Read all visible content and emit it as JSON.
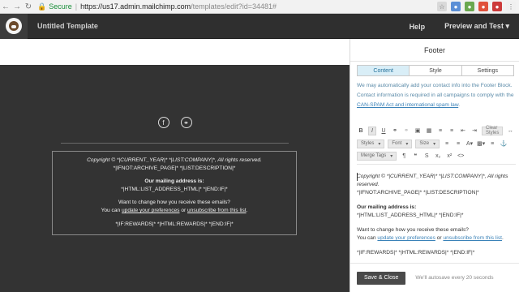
{
  "browser": {
    "secure_label": "Secure",
    "url_host": "https://us17.admin.mailchimp.com",
    "url_path": "/templates/edit?id=34481#"
  },
  "header": {
    "template_title": "Untitled Template",
    "help": "Help",
    "preview": "Preview and Test"
  },
  "canvas": {
    "footer_lines": {
      "copyright": "Copyright © *|CURRENT_YEAR|* *|LIST:COMPANY|*, All rights reserved.",
      "archive": "*|IFNOT:ARCHIVE_PAGE|* *|LIST:DESCRIPTION|*",
      "mailing_heading": "Our mailing address is:",
      "address": "*|HTML:LIST_ADDRESS_HTML|* *|END:IF|*",
      "change_q": "Want to change how you receive these emails?",
      "you_can": "You can ",
      "update_link": "update your preferences",
      "or": " or ",
      "unsub_link": "unsubscribe from this list",
      "period": ".",
      "rewards": "*|IF:REWARDS|* *|HTML:REWARDS|* *|END:IF|*"
    }
  },
  "panel": {
    "title": "Footer",
    "tabs": [
      "Content",
      "Style",
      "Settings"
    ],
    "active_tab": "Content",
    "info_text": "We may automatically add your contact info into the Footer Block. Contact information is required in all campaigns to comply with the ",
    "info_link": "CAN-SPAM Act and international spam law",
    "info_end": ".",
    "toolbar": {
      "clear_styles": "Clear Styles",
      "styles": "Styles",
      "font": "Font",
      "size": "Size",
      "merge_tags": "Merge Tags"
    },
    "editor": {
      "copyright": "Copyright © *|CURRENT_YEAR|* *|LIST:COMPANY|*, All rights reserved.",
      "archive": "*|IFNOT:ARCHIVE_PAGE|* *|LIST:DESCRIPTION|*",
      "mailing_heading": "Our mailing address is:",
      "address": "*|HTML:LIST_ADDRESS_HTML|* *|END:IF|*",
      "change_q": "Want to change how you receive these emails?",
      "you_can": "You can ",
      "update_link": "update your preferences",
      "or": " or ",
      "unsub_link": "unsubscribe from this list",
      "period": ".",
      "rewards": "*|IF:REWARDS|* *|HTML:REWARDS|* *|END:IF|*"
    },
    "save_label": "Save & Close",
    "autosave": "We'll autosave every 20 seconds"
  },
  "colors": {
    "active_tab_bg": "#d9eef7",
    "link": "#3a82b8",
    "header_bg": "#2f2f2f"
  }
}
